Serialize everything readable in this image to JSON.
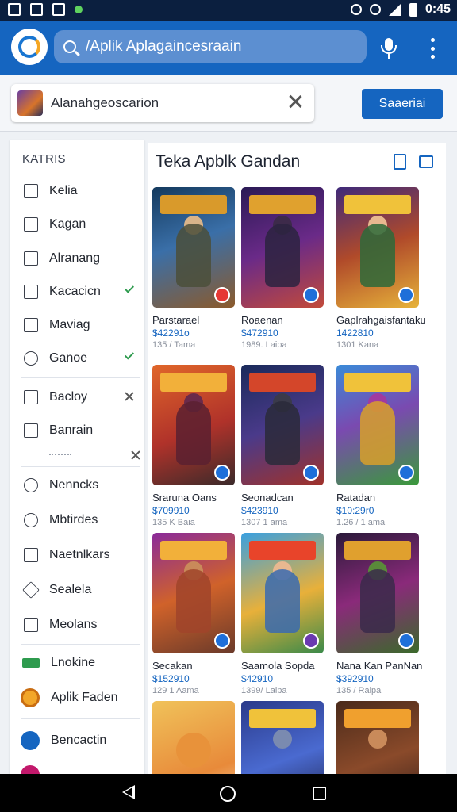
{
  "status_bar": {
    "time": "0:45"
  },
  "app_bar": {
    "search_text": "/Aplik Aplagaincesraain"
  },
  "query": {
    "chip_text": "Alanahgeoscarion",
    "button_label": "Saaeriai"
  },
  "sidebar": {
    "heading": "KATRIS",
    "items": [
      {
        "label": "Kelia",
        "icon": "checkbox-icon",
        "mark": ""
      },
      {
        "label": "Kagan",
        "icon": "bag-icon",
        "mark": ""
      },
      {
        "label": "Alranang",
        "icon": "calendar-icon",
        "mark": ""
      },
      {
        "label": "Kacacicn",
        "icon": "folder-icon",
        "mark": "check"
      },
      {
        "label": "Maviag",
        "icon": "box-icon",
        "mark": ""
      },
      {
        "label": "Ganoe",
        "icon": "circle-icon",
        "mark": "check"
      },
      {
        "label": "Bacloy",
        "icon": "briefcase-icon",
        "mark": "x"
      },
      {
        "label": "Banrain",
        "icon": "book-icon",
        "mark": ""
      },
      {
        "label": "Nenncks",
        "icon": "clock-icon",
        "mark": ""
      },
      {
        "label": "Mbtirdes",
        "icon": "heart-icon",
        "mark": ""
      },
      {
        "label": "Naetnlkars",
        "icon": "frame-icon",
        "mark": ""
      },
      {
        "label": "Sealela",
        "icon": "diamond-icon",
        "mark": ""
      },
      {
        "label": "Meolans",
        "icon": "bag-icon",
        "mark": ""
      },
      {
        "label": "Lnokine",
        "icon": "green-tag-icon",
        "mark": ""
      },
      {
        "label": "Aplik Faden",
        "icon": "coin-icon",
        "mark": ""
      },
      {
        "label": "Bencactin",
        "icon": "app-circle-icon",
        "mark": ""
      }
    ],
    "sub_close_mark": "x"
  },
  "main": {
    "title": "Teka Apblk Gandan",
    "cards": [
      {
        "name": "Parstarael",
        "price": "$42291o",
        "downloads": "135 / Tama"
      },
      {
        "name": "Roaenan",
        "price": "$472910",
        "downloads": "1989. Laipa"
      },
      {
        "name": "Gaplrahgaisfantakun",
        "price": "1422810",
        "downloads": "1301 Kana"
      },
      {
        "name": "Sraruna Oans",
        "price": "$709910",
        "downloads": "135 K Baia"
      },
      {
        "name": "Seonadcan",
        "price": "$423910",
        "downloads": "1307 1 ama"
      },
      {
        "name": "Ratadan",
        "price": "$10:29r0",
        "downloads": "1.26 / 1 ama"
      },
      {
        "name": "Secakan",
        "price": "$152910",
        "downloads": "129 1 Aama"
      },
      {
        "name": "Saamola Sopda",
        "price": "$42910",
        "downloads": "1399/ Laipa"
      },
      {
        "name": "Nana Kan PanNan",
        "price": "$392910",
        "downloads": "135 / Raipa"
      },
      {
        "name": "",
        "price": "",
        "downloads": ""
      },
      {
        "name": "",
        "price": "",
        "downloads": ""
      },
      {
        "name": "",
        "price": "",
        "downloads": ""
      }
    ]
  },
  "colors": {
    "primary": "#1565c0",
    "status_bar": "#0b1f3f",
    "check_green": "#2e9b4e"
  }
}
